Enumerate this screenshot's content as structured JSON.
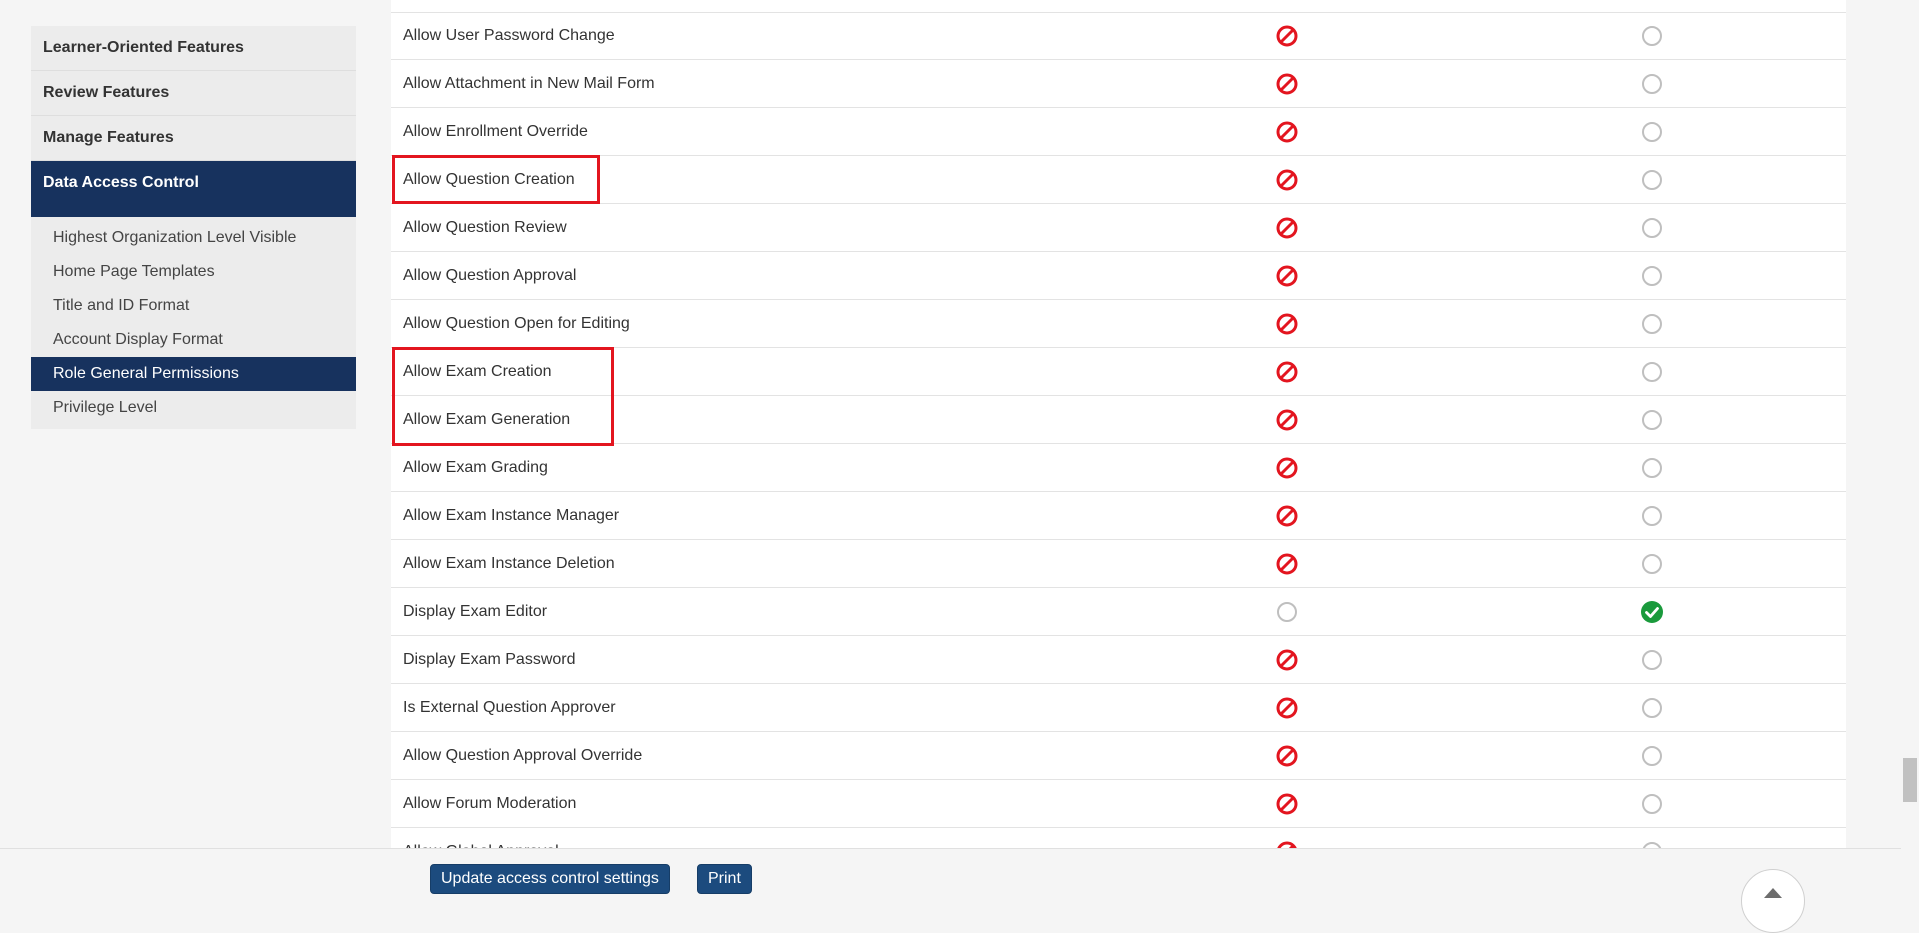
{
  "sidebar": {
    "sections": [
      {
        "label": "Learner-Oriented Features"
      },
      {
        "label": "Review Features"
      },
      {
        "label": "Manage Features"
      },
      {
        "label": "Data Access Control"
      }
    ],
    "subitems": [
      {
        "label": "Highest Organization Level Visible"
      },
      {
        "label": "Home Page Templates"
      },
      {
        "label": "Title and ID Format"
      },
      {
        "label": "Account Display Format"
      },
      {
        "label": "Role General Permissions"
      },
      {
        "label": "Privilege Level"
      }
    ]
  },
  "permissions": {
    "rows": [
      {
        "label": "Allow User Password Change",
        "state": "deny"
      },
      {
        "label": "Allow Attachment in New Mail Form",
        "state": "deny"
      },
      {
        "label": "Allow Enrollment Override",
        "state": "deny"
      },
      {
        "label": "Allow Question Creation",
        "state": "deny"
      },
      {
        "label": "Allow Question Review",
        "state": "deny"
      },
      {
        "label": "Allow Question Approval",
        "state": "deny"
      },
      {
        "label": "Allow Question Open for Editing",
        "state": "deny"
      },
      {
        "label": "Allow Exam Creation",
        "state": "deny"
      },
      {
        "label": "Allow Exam Generation",
        "state": "deny"
      },
      {
        "label": "Allow Exam Grading",
        "state": "deny"
      },
      {
        "label": "Allow Exam Instance Manager",
        "state": "deny"
      },
      {
        "label": "Allow Exam Instance Deletion",
        "state": "deny"
      },
      {
        "label": "Display Exam Editor",
        "state": "allow"
      },
      {
        "label": "Display Exam Password",
        "state": "deny"
      },
      {
        "label": "Is External Question Approver",
        "state": "deny"
      },
      {
        "label": "Allow Question Approval Override",
        "state": "deny"
      },
      {
        "label": "Allow Forum Moderation",
        "state": "deny"
      },
      {
        "label": "Allow Global Approval",
        "state": "deny"
      }
    ]
  },
  "footer": {
    "update_label": "Update access control settings",
    "print_label": "Print"
  },
  "colors": {
    "deny": "#e3151f",
    "allow": "#1a9a3c",
    "nav_active": "#17325e",
    "button": "#1c4b7e",
    "highlight": "#e3151f"
  }
}
